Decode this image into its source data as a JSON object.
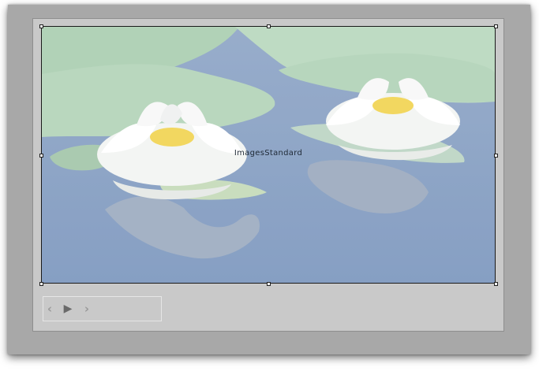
{
  "component": {
    "label": "ImagesStandard"
  },
  "image": {
    "subject": "white water lilies on a pond",
    "palette": {
      "water": "#7f98bd",
      "lily_pad": "#a9cdb0",
      "petal": "#f4f5f4",
      "stamen": "#f2d44a"
    }
  },
  "navigation": {
    "prev_icon": "chevron-left-icon",
    "play_icon": "play-icon",
    "next_icon": "chevron-right-icon",
    "prev_glyph": "‹",
    "play_glyph": "▶",
    "next_glyph": "›"
  }
}
